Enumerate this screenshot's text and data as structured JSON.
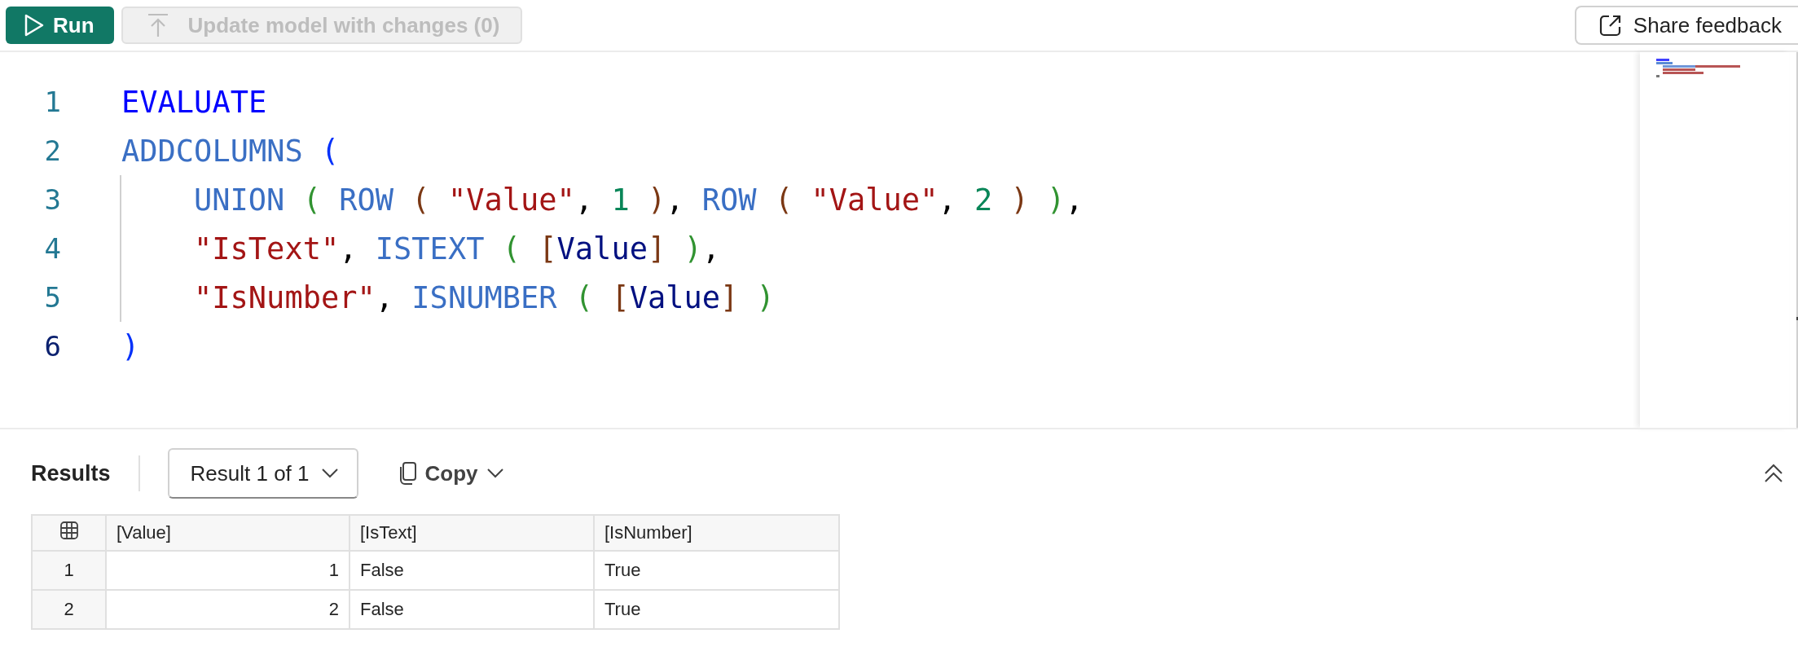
{
  "toolbar": {
    "run_button": {
      "label": "Run"
    },
    "update_button": {
      "label": "Update model with changes (0)",
      "disabled": true
    },
    "feedback_button": {
      "label": "Share feedback"
    }
  },
  "editor": {
    "lines": [
      {
        "number": "1",
        "active": false,
        "indent": false,
        "tokens": [
          {
            "kind": "keyword",
            "text": "EVALUATE"
          }
        ]
      },
      {
        "number": "2",
        "active": false,
        "indent": false,
        "tokens": [
          {
            "kind": "function",
            "text": "ADDCOLUMNS"
          },
          {
            "kind": "bracket1",
            "text": " ("
          }
        ]
      },
      {
        "number": "3",
        "active": false,
        "indent": true,
        "tokens": [
          {
            "kind": "function",
            "text": "UNION"
          },
          {
            "kind": "bracket2",
            "text": " ("
          },
          {
            "kind": "function",
            "text": " ROW"
          },
          {
            "kind": "bracket3",
            "text": " ("
          },
          {
            "kind": "string",
            "text": " \"Value\""
          },
          {
            "kind": "plain",
            "text": ", "
          },
          {
            "kind": "number",
            "text": "1"
          },
          {
            "kind": "bracket3",
            "text": " )"
          },
          {
            "kind": "plain",
            "text": ", "
          },
          {
            "kind": "function",
            "text": "ROW"
          },
          {
            "kind": "bracket3",
            "text": " ("
          },
          {
            "kind": "string",
            "text": " \"Value\""
          },
          {
            "kind": "plain",
            "text": ", "
          },
          {
            "kind": "number",
            "text": "2"
          },
          {
            "kind": "bracket3",
            "text": " )"
          },
          {
            "kind": "bracket2",
            "text": " )"
          },
          {
            "kind": "plain",
            "text": ","
          }
        ]
      },
      {
        "number": "4",
        "active": false,
        "indent": true,
        "tokens": [
          {
            "kind": "string",
            "text": "\"IsText\""
          },
          {
            "kind": "plain",
            "text": ", "
          },
          {
            "kind": "function",
            "text": "ISTEXT"
          },
          {
            "kind": "bracket2",
            "text": " ("
          },
          {
            "kind": "bracket3",
            "text": " ["
          },
          {
            "kind": "column",
            "text": "Value"
          },
          {
            "kind": "bracket3",
            "text": "]"
          },
          {
            "kind": "bracket2",
            "text": " )"
          },
          {
            "kind": "plain",
            "text": ","
          }
        ]
      },
      {
        "number": "5",
        "active": false,
        "indent": true,
        "tokens": [
          {
            "kind": "string",
            "text": "\"IsNumber\""
          },
          {
            "kind": "plain",
            "text": ", "
          },
          {
            "kind": "function",
            "text": "ISNUMBER"
          },
          {
            "kind": "bracket2",
            "text": " ("
          },
          {
            "kind": "bracket3",
            "text": " ["
          },
          {
            "kind": "column",
            "text": "Value"
          },
          {
            "kind": "bracket3",
            "text": "]"
          },
          {
            "kind": "bracket2",
            "text": " )"
          }
        ]
      },
      {
        "number": "6",
        "active": true,
        "indent": false,
        "tokens": [
          {
            "kind": "bracket1",
            "text": ")"
          }
        ]
      }
    ]
  },
  "results": {
    "title": "Results",
    "result_selector": "Result 1 of 1",
    "copy_button": "Copy",
    "table": {
      "columns": [
        "[Value]",
        "[IsText]",
        "[IsNumber]"
      ],
      "rows": [
        {
          "number": "1",
          "cells": [
            "1",
            "False",
            "True"
          ]
        },
        {
          "number": "2",
          "cells": [
            "2",
            "False",
            "True"
          ]
        }
      ]
    }
  }
}
